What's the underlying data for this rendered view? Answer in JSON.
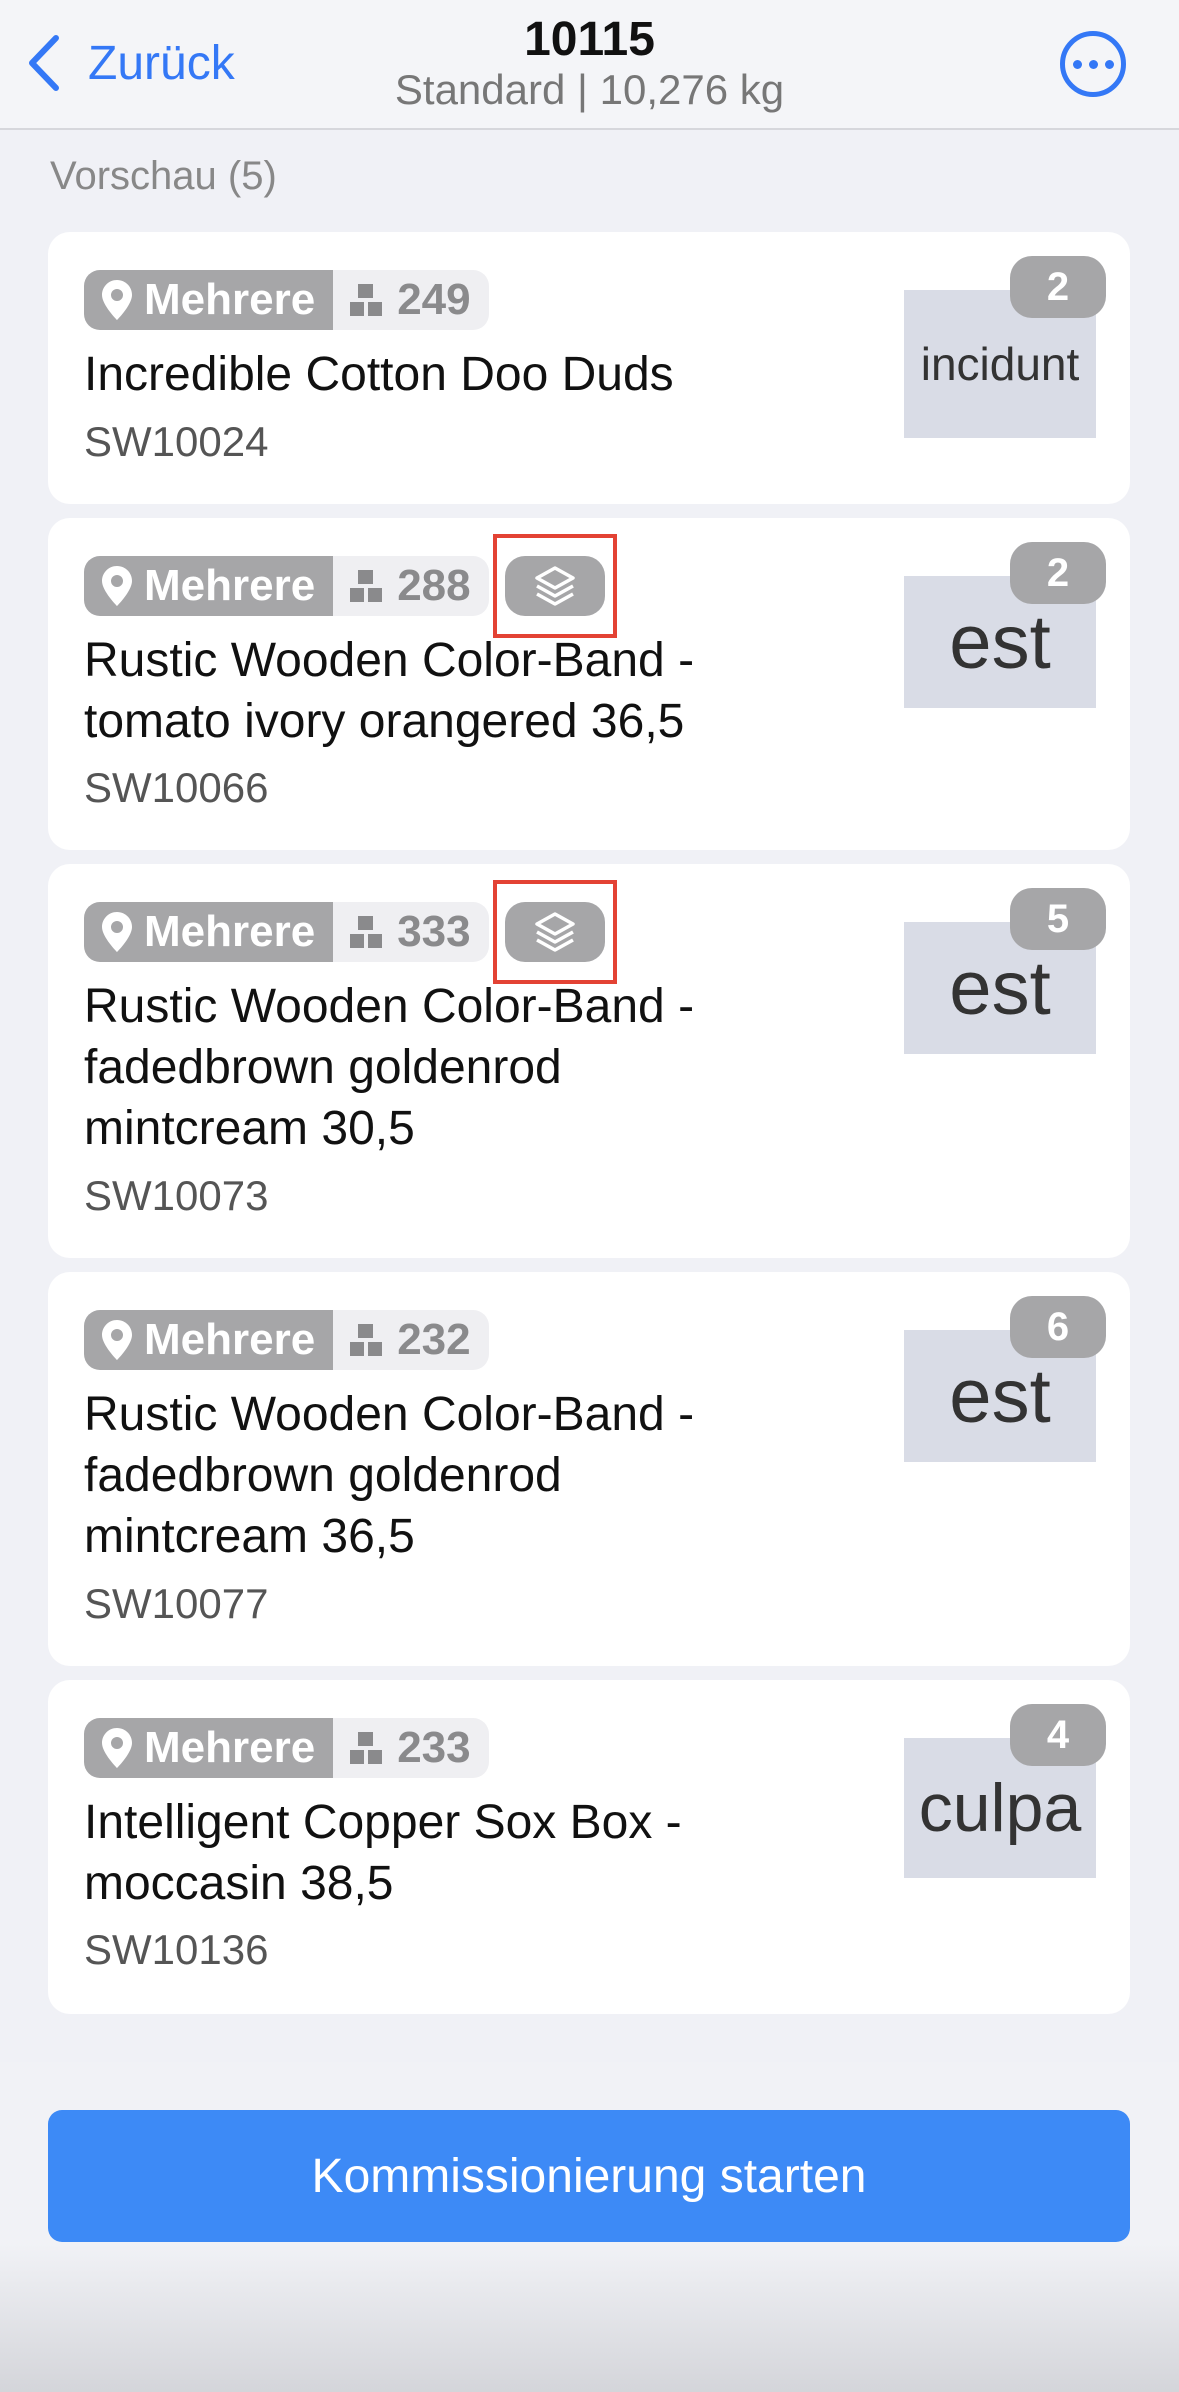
{
  "nav": {
    "back_label": "Zurück",
    "title": "10115",
    "subtitle": "Standard | 10,276 kg"
  },
  "section_label": "Vorschau (5)",
  "items": [
    {
      "location": "Mehrere",
      "quantity": "249",
      "name_lines": [
        "Incredible Cotton Doo Duds"
      ],
      "sku": "SW10024",
      "thumb_text": "incidunt",
      "count": "2",
      "has_layers_badge": false
    },
    {
      "location": "Mehrere",
      "quantity": "288",
      "name_lines": [
        "Rustic Wooden Color-Band -",
        "tomato ivory orangered 36,5"
      ],
      "sku": "SW10066",
      "thumb_text": "est",
      "count": "2",
      "has_layers_badge": true
    },
    {
      "location": "Mehrere",
      "quantity": "333",
      "name_lines": [
        "Rustic Wooden Color-Band -",
        "fadedbrown goldenrod",
        "mintcream 30,5"
      ],
      "sku": "SW10073",
      "thumb_text": "est",
      "count": "5",
      "has_layers_badge": true
    },
    {
      "location": "Mehrere",
      "quantity": "232",
      "name_lines": [
        "Rustic Wooden Color-Band -",
        "fadedbrown goldenrod",
        "mintcream 36,5"
      ],
      "sku": "SW10077",
      "thumb_text": "est",
      "count": "6",
      "has_layers_badge": false
    },
    {
      "location": "Mehrere",
      "quantity": "233",
      "name_lines": [
        "Intelligent Copper Sox Box -",
        "moccasin 38,5"
      ],
      "sku": "SW10136",
      "thumb_text": "culpa",
      "count": "4",
      "has_layers_badge": false
    }
  ],
  "start_button_label": "Kommissionierung starten",
  "colors": {
    "accent": "#3478f6",
    "tag_gray": "#a6a6a8",
    "highlight_red": "#e34234"
  },
  "icons": [
    "chevron-left-icon",
    "more-icon",
    "location-pin-icon",
    "boxes-icon",
    "layers-icon"
  ]
}
